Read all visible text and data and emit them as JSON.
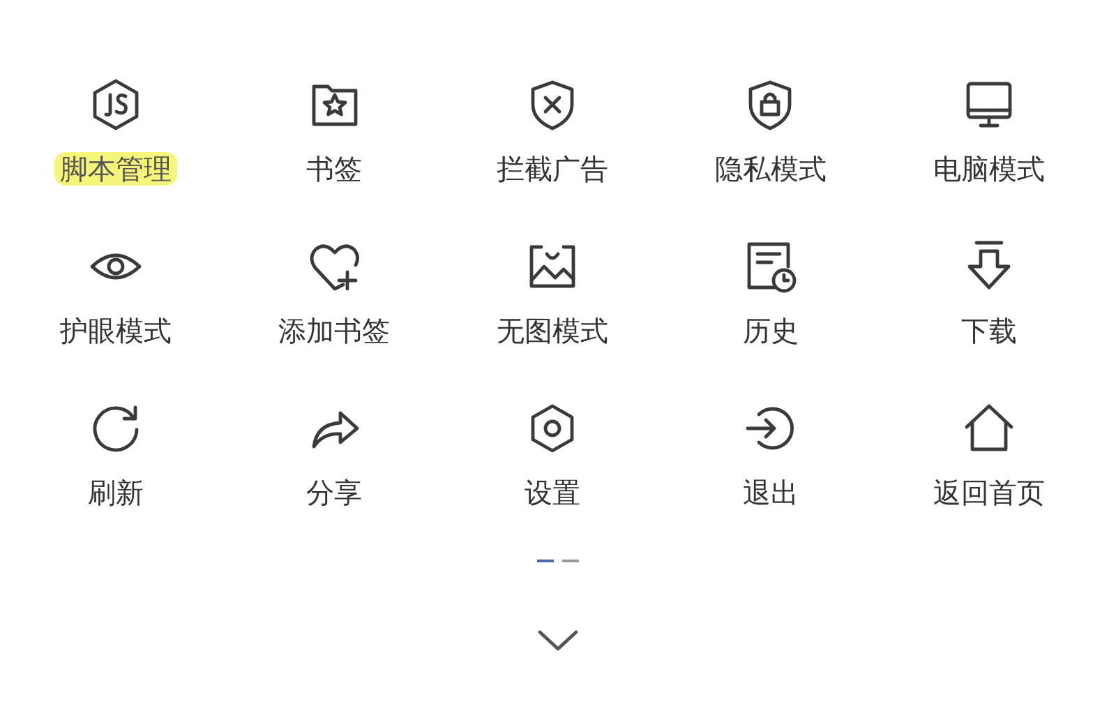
{
  "menu_items": [
    {
      "label": "脚本管理",
      "kind": "script",
      "highlighted": true
    },
    {
      "label": "书签",
      "kind": "bookmark",
      "highlighted": false
    },
    {
      "label": "拦截广告",
      "kind": "adblock",
      "highlighted": false
    },
    {
      "label": "隐私模式",
      "kind": "privacy",
      "highlighted": false
    },
    {
      "label": "电脑模式",
      "kind": "desktop",
      "highlighted": false
    },
    {
      "label": "护眼模式",
      "kind": "eye",
      "highlighted": false
    },
    {
      "label": "添加书签",
      "kind": "addbookmark",
      "highlighted": false
    },
    {
      "label": "无图模式",
      "kind": "noimage",
      "highlighted": false
    },
    {
      "label": "历史",
      "kind": "history",
      "highlighted": false
    },
    {
      "label": "下载",
      "kind": "download",
      "highlighted": false
    },
    {
      "label": "刷新",
      "kind": "refresh",
      "highlighted": false
    },
    {
      "label": "分享",
      "kind": "share",
      "highlighted": false
    },
    {
      "label": "设置",
      "kind": "settings",
      "highlighted": false
    },
    {
      "label": "退出",
      "kind": "exit",
      "highlighted": false
    },
    {
      "label": "返回首页",
      "kind": "home",
      "highlighted": false
    }
  ],
  "pages": [
    {
      "selected": true
    },
    {
      "selected": false
    }
  ]
}
